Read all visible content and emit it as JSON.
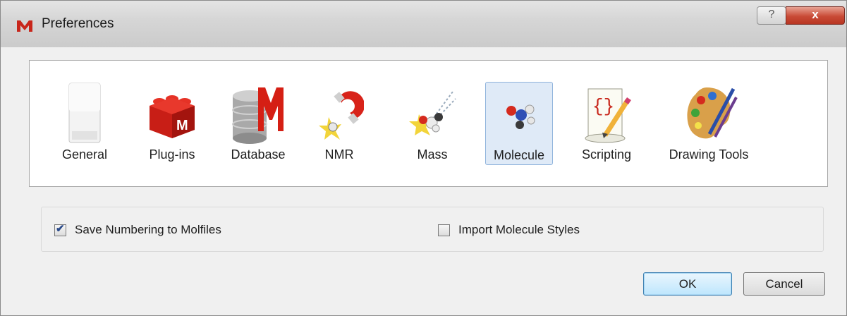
{
  "window": {
    "title": "Preferences",
    "app_icon": "mnova-logo-icon"
  },
  "titlebar": {
    "help_label": "?",
    "close_label": "x"
  },
  "tabs": [
    {
      "label": "General",
      "icon": "general-icon",
      "selected": false
    },
    {
      "label": "Plug-ins",
      "icon": "plugins-lego-icon",
      "selected": false
    },
    {
      "label": "Database",
      "icon": "database-icon",
      "selected": false
    },
    {
      "label": "NMR",
      "icon": "nmr-magnet-icon",
      "selected": false
    },
    {
      "label": "Mass",
      "icon": "mass-spec-icon",
      "selected": false
    },
    {
      "label": "Molecule",
      "icon": "molecule-icon",
      "selected": true
    },
    {
      "label": "Scripting",
      "icon": "scripting-scroll-icon",
      "selected": false
    },
    {
      "label": "Drawing Tools",
      "icon": "paint-palette-icon",
      "selected": false
    }
  ],
  "options": {
    "save_numbering": {
      "label": "Save Numbering to Molfiles",
      "checked": true
    },
    "import_styles": {
      "label": "Import Molecule Styles",
      "checked": false
    }
  },
  "buttons": {
    "ok": "OK",
    "cancel": "Cancel"
  },
  "colors": {
    "selected_tab": "#dfeaf7",
    "close_button": "#c94a36",
    "ok_button": "#bee6fd"
  }
}
